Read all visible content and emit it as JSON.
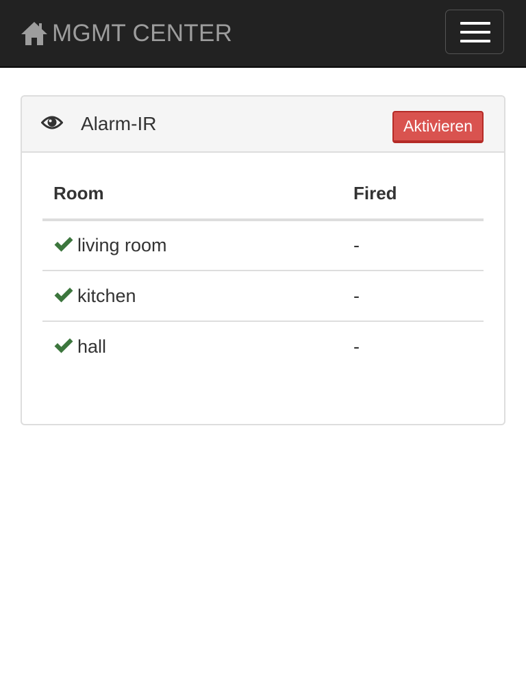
{
  "navbar": {
    "brand": "MGMT CENTER",
    "brand_icon": "home-icon",
    "menu_icon": "hamburger-menu-icon"
  },
  "panel": {
    "icon": "eye-icon",
    "title": "Alarm-IR",
    "activate_button": "Aktivieren",
    "button_color": "#d9534f"
  },
  "table": {
    "headers": {
      "room": "Room",
      "fired": "Fired"
    },
    "rows": [
      {
        "status_icon": "check-icon",
        "room": "living room",
        "fired": "-"
      },
      {
        "status_icon": "check-icon",
        "room": "kitchen",
        "fired": "-"
      },
      {
        "status_icon": "check-icon",
        "room": "hall",
        "fired": "-"
      }
    ],
    "status_color": "#3c763d"
  }
}
